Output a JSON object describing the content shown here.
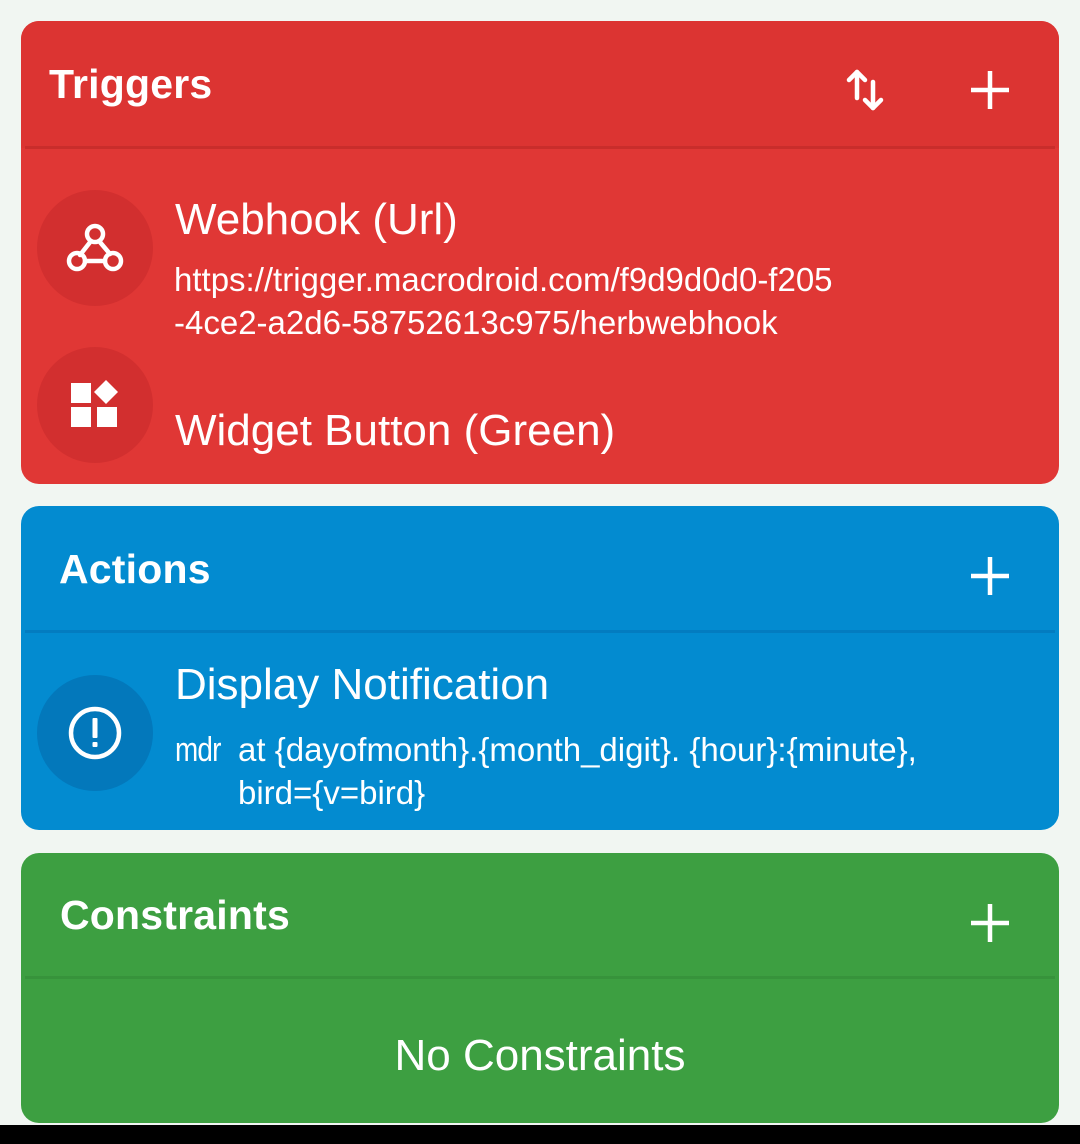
{
  "colors": {
    "background": "#f1f6f2",
    "triggers": "#e03735",
    "triggers_header": "#dc3432",
    "triggers_circle": "#d22f2f",
    "actions": "#038bd0",
    "actions_circle": "#0378bb",
    "constraints": "#3d9f41"
  },
  "triggers": {
    "title": "Triggers",
    "header_icons": [
      "reorder-icon",
      "plus-icon"
    ],
    "items": [
      {
        "icon": "webhook-icon",
        "title": "Webhook (Url)",
        "detail_line1": "https://trigger.macrodroid.com/f9d9d0d0-f205",
        "detail_line2": "-4ce2-a2d6-58752613c975/herbwebhook"
      },
      {
        "icon": "widget-icon",
        "title": "Widget Button (Green)"
      }
    ]
  },
  "actions": {
    "title": "Actions",
    "header_icons": [
      "plus-icon"
    ],
    "items": [
      {
        "icon": "alert-circle-icon",
        "title": "Display Notification",
        "prefix": "mdr",
        "detail_line1": "at {dayofmonth}.{month_digit}.  {hour}:{minute},",
        "detail_line2": "bird={v=bird}"
      }
    ]
  },
  "constraints": {
    "title": "Constraints",
    "header_icons": [
      "plus-icon"
    ],
    "empty_text": "No Constraints"
  }
}
